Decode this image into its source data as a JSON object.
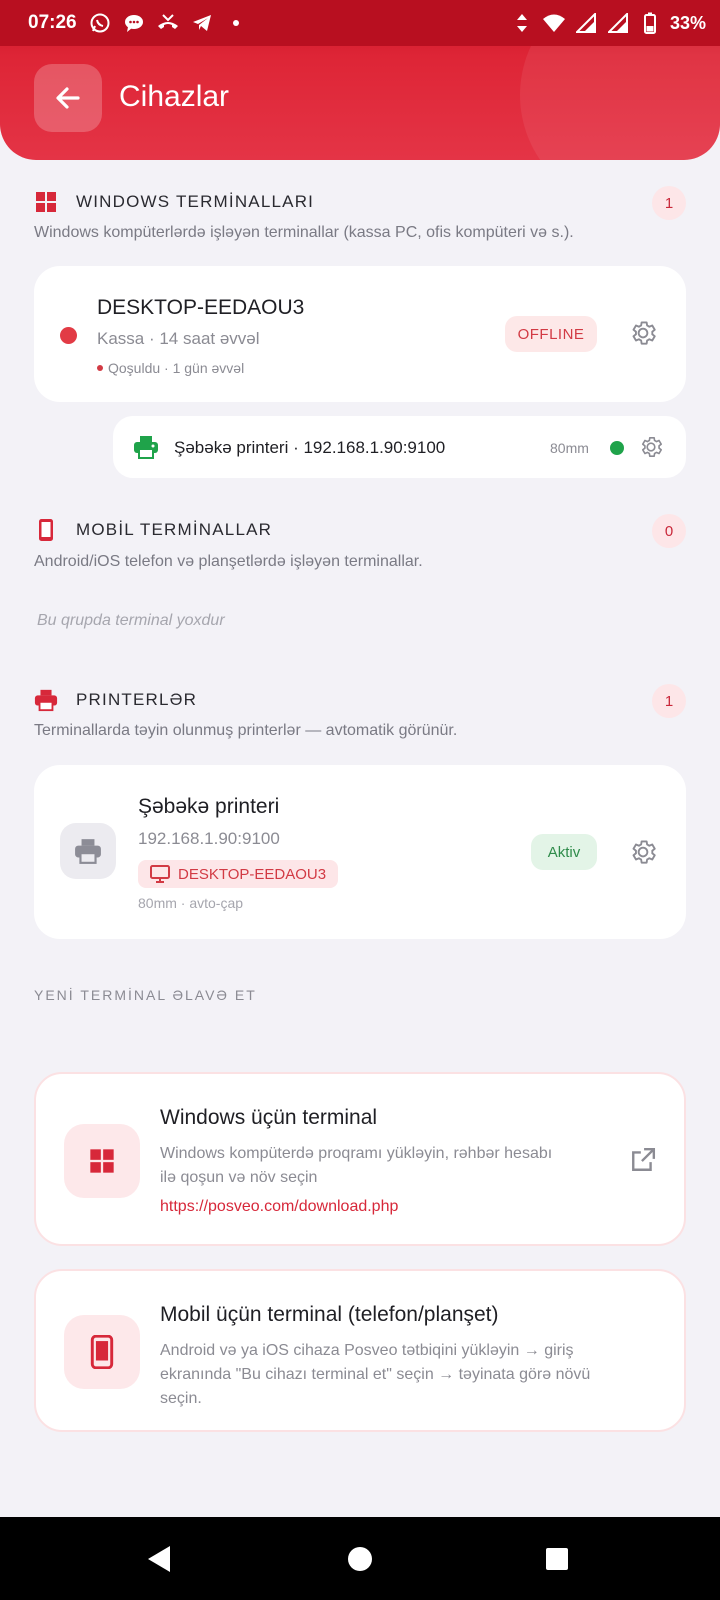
{
  "status_bar": {
    "time": "07:26",
    "battery": "33%",
    "icons_left": [
      "whatsapp-icon",
      "chat-icon",
      "missed-call-icon",
      "telegram-icon",
      "dot-icon"
    ],
    "icons_right": [
      "data-arrows-icon",
      "wifi-icon",
      "signal-icon",
      "signal-icon",
      "battery-icon"
    ]
  },
  "header": {
    "title": "Cihazlar"
  },
  "windows_section": {
    "title": "WINDOWS TERMİNALLARI",
    "count": "1",
    "description": "Windows kompüterlərdə işləyən terminallar (kassa PC, ofis kompüteri və s.).",
    "terminal": {
      "name": "DESKTOP-EEDAOU3",
      "subtitle": "Kassa · 14 saat əvvəl",
      "connected": "Qoşuldu · 1 gün əvvəl",
      "status": "OFFLINE"
    },
    "printer": {
      "label": "Şəbəkə printeri · 192.168.1.90:9100",
      "paper": "80mm"
    }
  },
  "mobile_section": {
    "title": "MOBİL TERMİNALLAR",
    "count": "0",
    "description": "Android/iOS telefon və planşetlərdə işləyən terminallar.",
    "empty": "Bu qrupda terminal yoxdur"
  },
  "printers_section": {
    "title": "PRINTERLƏR",
    "count": "1",
    "description": "Terminallarda təyin olunmuş printerlər — avtomatik görünür.",
    "printer": {
      "name": "Şəbəkə printeri",
      "address": "192.168.1.90:9100",
      "terminal": "DESKTOP-EEDAOU3",
      "meta": "80mm · avto-çap",
      "status": "Aktiv"
    }
  },
  "add_section": {
    "title": "YENİ TERMİNAL ƏLAVƏ ET",
    "windows": {
      "title": "Windows üçün terminal",
      "desc_line1": "Windows kompüterdə proqramı yükləyin, rəhbər hesabı",
      "desc_line2": "ilə qoşun və növ seçin",
      "link": "https://posveo.com/download.php"
    },
    "mobile": {
      "title": "Mobil üçün terminal (telefon/planşet)",
      "desc_line1": "Android və ya iOS cihaza Posveo tətbiqini yükləyin → giriş",
      "desc_line2": "ekranında \"Bu cihazı terminal et\" seçin → təyinata görə növü",
      "desc_line3": "seçin."
    }
  },
  "colors": {
    "brand_red": "#d7192d",
    "online_green": "#1fa34a",
    "offline_red": "#e23b45"
  }
}
